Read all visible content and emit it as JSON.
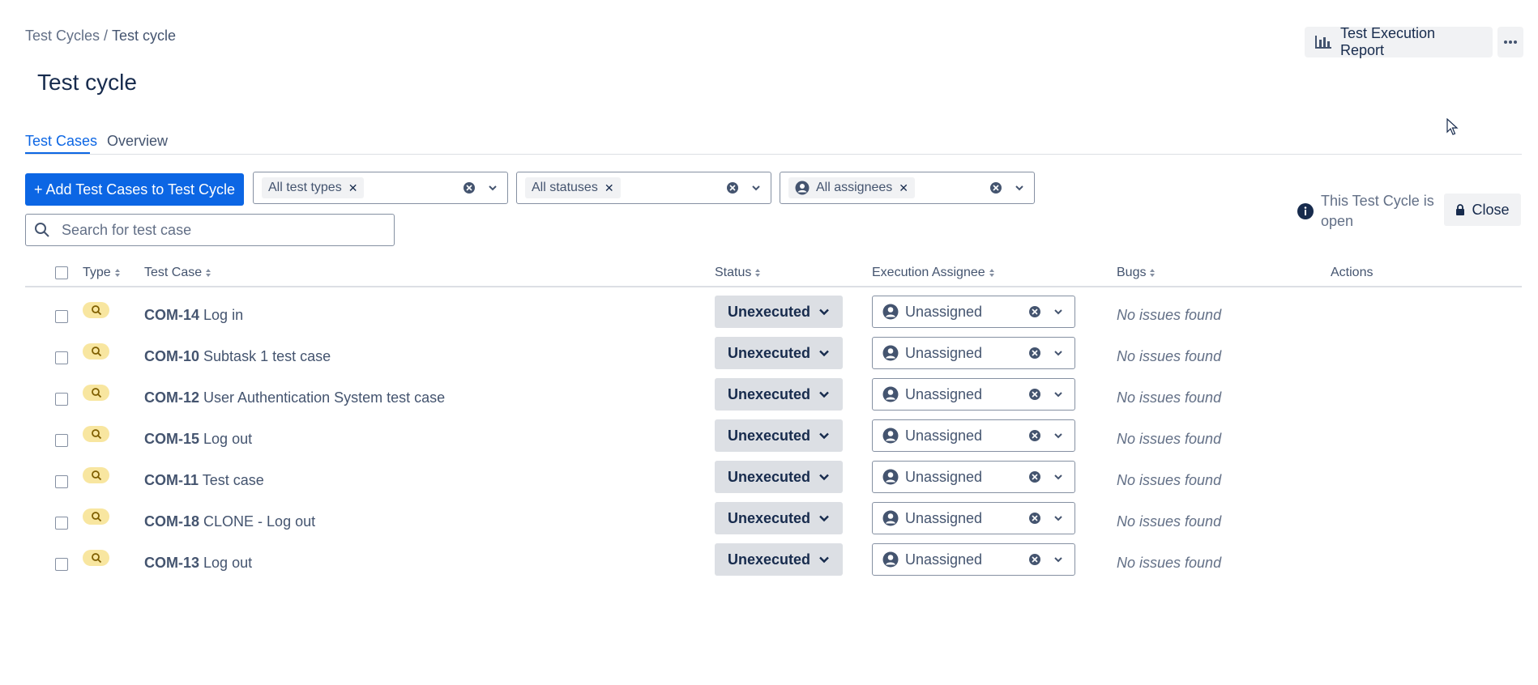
{
  "breadcrumb": {
    "parent": "Test Cycles",
    "separator": "/",
    "current": "Test cycle"
  },
  "page": {
    "title": "Test cycle"
  },
  "header": {
    "report_label": "Test Execution Report"
  },
  "tabs": [
    {
      "label": "Test Cases",
      "active": true
    },
    {
      "label": "Overview",
      "active": false
    }
  ],
  "toolbar": {
    "add_label": "+ Add Test Cases to Test Cycle",
    "filters": {
      "types": "All test types",
      "statuses": "All statuses",
      "assignees": "All assignees"
    },
    "search_placeholder": "Search for test case"
  },
  "cycle_status": {
    "text": "This Test Cycle is open",
    "close_label": "Close"
  },
  "table": {
    "headers": {
      "type": "Type",
      "test_case": "Test Case",
      "status": "Status",
      "assignee": "Execution Assignee",
      "bugs": "Bugs",
      "actions": "Actions"
    },
    "rows": [
      {
        "key": "COM-14",
        "title": "Log in",
        "status": "Unexecuted",
        "assignee": "Unassigned",
        "bugs": "No issues found"
      },
      {
        "key": "COM-10",
        "title": "Subtask 1 test case",
        "status": "Unexecuted",
        "assignee": "Unassigned",
        "bugs": "No issues found"
      },
      {
        "key": "COM-12",
        "title": "User Authentication System test case",
        "status": "Unexecuted",
        "assignee": "Unassigned",
        "bugs": "No issues found"
      },
      {
        "key": "COM-15",
        "title": "Log out",
        "status": "Unexecuted",
        "assignee": "Unassigned",
        "bugs": "No issues found"
      },
      {
        "key": "COM-11",
        "title": "Test case",
        "status": "Unexecuted",
        "assignee": "Unassigned",
        "bugs": "No issues found"
      },
      {
        "key": "COM-18",
        "title": "CLONE - Log out",
        "status": "Unexecuted",
        "assignee": "Unassigned",
        "bugs": "No issues found"
      },
      {
        "key": "COM-13",
        "title": "Log out",
        "status": "Unexecuted",
        "assignee": "Unassigned",
        "bugs": "No issues found"
      }
    ]
  },
  "icons": {
    "report": "bar-chart-icon",
    "more": "ellipsis-icon",
    "search": "search-icon",
    "clear": "clear-circle-icon",
    "chevron": "chevron-down-icon",
    "user": "user-avatar-icon",
    "info": "info-icon",
    "lock": "lock-icon",
    "type": "search-test-type-icon",
    "sort": "sort-icon"
  },
  "colors": {
    "primary": "#0c66e4",
    "badge": "#f8e6a0",
    "status_bg": "#dcdfe4",
    "neutral_bg": "#f1f2f4"
  }
}
